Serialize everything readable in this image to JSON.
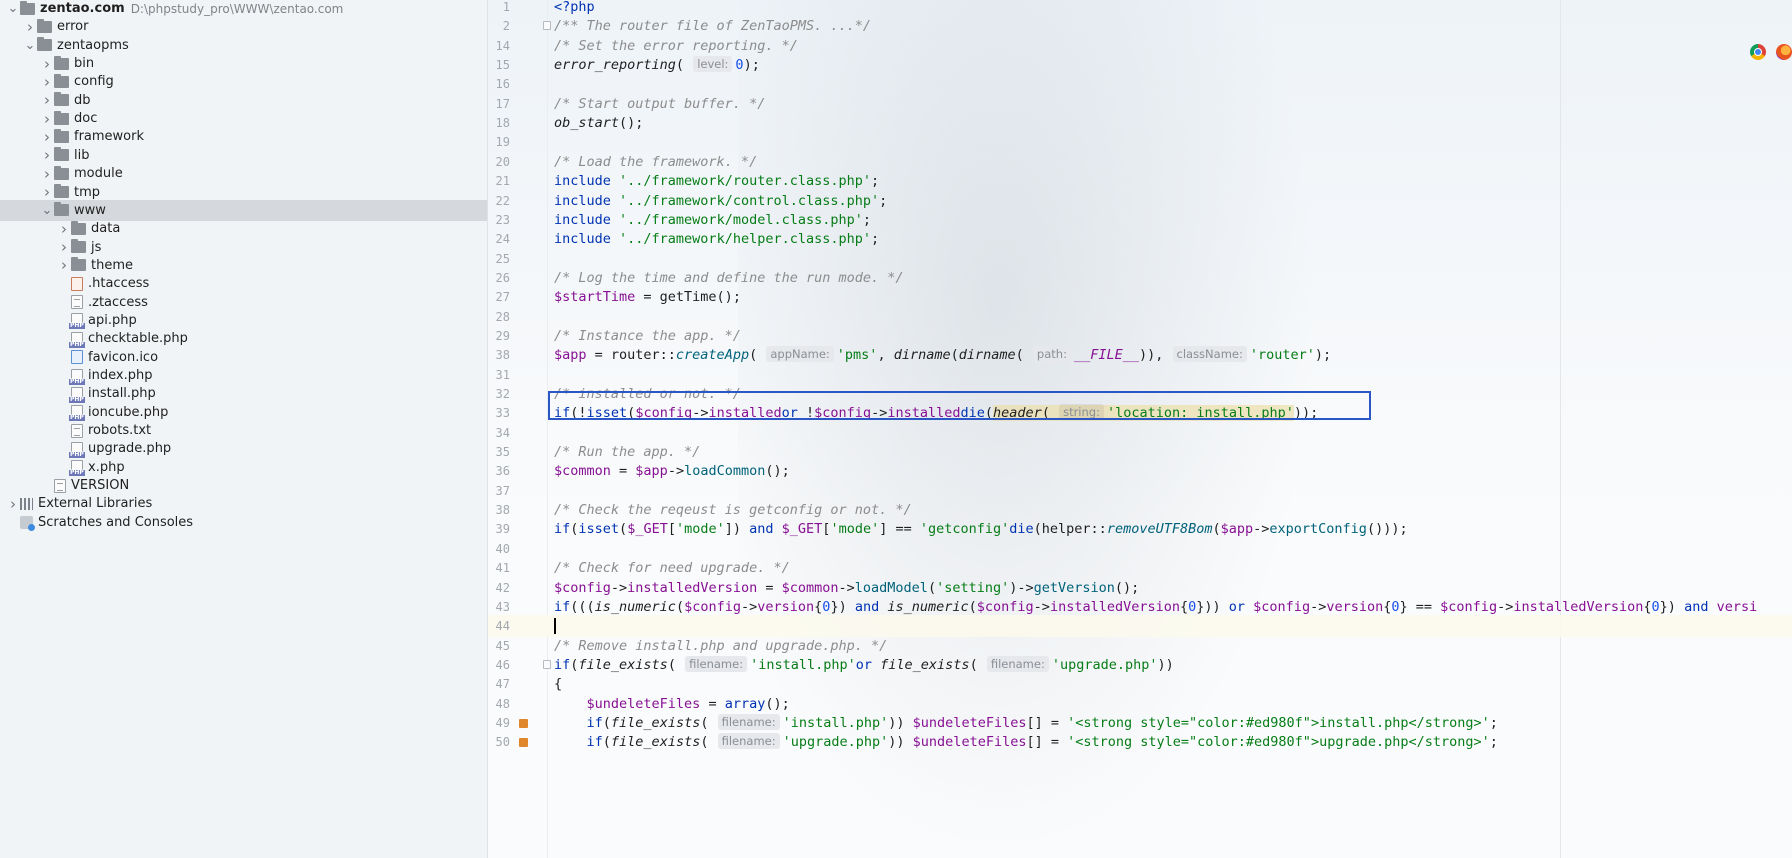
{
  "project_tree": {
    "rows": [
      {
        "depth": 0,
        "type": "folder",
        "expanded": true,
        "label": "zentao.com",
        "path": "D:\\phpstudy_pro\\WWW\\zentao.com",
        "bold": true
      },
      {
        "depth": 1,
        "type": "folder",
        "expanded": false,
        "label": "error"
      },
      {
        "depth": 1,
        "type": "folder",
        "expanded": true,
        "label": "zentaopms"
      },
      {
        "depth": 2,
        "type": "folder",
        "expanded": false,
        "label": "bin"
      },
      {
        "depth": 2,
        "type": "folder",
        "expanded": false,
        "label": "config"
      },
      {
        "depth": 2,
        "type": "folder",
        "expanded": false,
        "label": "db"
      },
      {
        "depth": 2,
        "type": "folder",
        "expanded": false,
        "label": "doc"
      },
      {
        "depth": 2,
        "type": "folder",
        "expanded": false,
        "label": "framework"
      },
      {
        "depth": 2,
        "type": "folder",
        "expanded": false,
        "label": "lib"
      },
      {
        "depth": 2,
        "type": "folder",
        "expanded": false,
        "label": "module"
      },
      {
        "depth": 2,
        "type": "folder",
        "expanded": false,
        "label": "tmp"
      },
      {
        "depth": 2,
        "type": "folder",
        "expanded": true,
        "label": "www",
        "selected": true
      },
      {
        "depth": 3,
        "type": "folder",
        "expanded": false,
        "label": "data"
      },
      {
        "depth": 3,
        "type": "folder",
        "expanded": false,
        "label": "js"
      },
      {
        "depth": 3,
        "type": "folder",
        "expanded": false,
        "label": "theme"
      },
      {
        "depth": 3,
        "type": "file",
        "icon": "htaccess",
        "label": ".htaccess"
      },
      {
        "depth": 3,
        "type": "file",
        "icon": "plain",
        "label": ".ztaccess"
      },
      {
        "depth": 3,
        "type": "file",
        "icon": "php",
        "label": "api.php"
      },
      {
        "depth": 3,
        "type": "file",
        "icon": "php",
        "label": "checktable.php"
      },
      {
        "depth": 3,
        "type": "file",
        "icon": "img",
        "label": "favicon.ico"
      },
      {
        "depth": 3,
        "type": "file",
        "icon": "php",
        "label": "index.php"
      },
      {
        "depth": 3,
        "type": "file",
        "icon": "php",
        "label": "install.php"
      },
      {
        "depth": 3,
        "type": "file",
        "icon": "php",
        "label": "ioncube.php"
      },
      {
        "depth": 3,
        "type": "file",
        "icon": "txt",
        "label": "robots.txt"
      },
      {
        "depth": 3,
        "type": "file",
        "icon": "php",
        "label": "upgrade.php"
      },
      {
        "depth": 3,
        "type": "file",
        "icon": "php",
        "label": "x.php"
      },
      {
        "depth": 2,
        "type": "file",
        "icon": "plain",
        "label": "VERSION"
      },
      {
        "depth": 0,
        "type": "library",
        "expanded": false,
        "label": "External Libraries"
      },
      {
        "depth": 0,
        "type": "scratch",
        "label": "Scratches and Consoles"
      }
    ]
  },
  "editor": {
    "selected_line": "38",
    "current_line": "44",
    "lines": [
      {
        "n": "1",
        "parts": [
          [
            "k",
            "<?php"
          ]
        ]
      },
      {
        "n": "2",
        "fold": true,
        "parts": [
          [
            "c",
            "/** The router file of ZenTaoPMS. ...*/"
          ]
        ]
      },
      {
        "n": "14",
        "parts": [
          [
            "c",
            "/* Set the error reporting. */"
          ]
        ]
      },
      {
        "n": "15",
        "parts": [
          [
            "fb",
            "error_reporting"
          ],
          [
            "",
            "( "
          ],
          [
            "hint",
            "level:"
          ],
          [
            "n",
            "0"
          ],
          [
            "",
            ");"
          ]
        ]
      },
      {
        "n": "16",
        "parts": []
      },
      {
        "n": "17",
        "parts": [
          [
            "c",
            "/* Start output buffer. */"
          ]
        ]
      },
      {
        "n": "18",
        "parts": [
          [
            "fb",
            "ob_start"
          ],
          [
            "",
            "();"
          ]
        ]
      },
      {
        "n": "19",
        "parts": []
      },
      {
        "n": "20",
        "parts": [
          [
            "c",
            "/* Load the framework. */"
          ]
        ]
      },
      {
        "n": "21",
        "parts": [
          [
            "k",
            "include "
          ],
          [
            "s",
            "'../framework/router.class.php'"
          ],
          [
            "",
            ";"
          ]
        ]
      },
      {
        "n": "22",
        "parts": [
          [
            "k",
            "include "
          ],
          [
            "s",
            "'../framework/control.class.php'"
          ],
          [
            "",
            ";"
          ]
        ]
      },
      {
        "n": "23",
        "parts": [
          [
            "k",
            "include "
          ],
          [
            "s",
            "'../framework/model.class.php'"
          ],
          [
            "",
            ";"
          ]
        ]
      },
      {
        "n": "24",
        "parts": [
          [
            "k",
            "include "
          ],
          [
            "s",
            "'../framework/helper.class.php'"
          ],
          [
            "",
            ";"
          ]
        ]
      },
      {
        "n": "25",
        "parts": []
      },
      {
        "n": "26",
        "parts": [
          [
            "c",
            "/* Log the time and define the run mode. */"
          ]
        ]
      },
      {
        "n": "27",
        "parts": [
          [
            "v",
            "$startTime"
          ],
          [
            "",
            " = getTime();"
          ]
        ]
      },
      {
        "n": "28",
        "parts": []
      },
      {
        "n": "29",
        "parts": [
          [
            "c",
            "/* Instance the app. */"
          ]
        ]
      },
      {
        "n": "38",
        "parts": [
          [
            "v",
            "$app"
          ],
          [
            "",
            " = router::"
          ],
          [
            "fi",
            "createApp"
          ],
          [
            "",
            "( "
          ],
          [
            "hint",
            "appName:"
          ],
          [
            "s",
            "'pms'"
          ],
          [
            "",
            ", "
          ],
          [
            "fb",
            "dirname"
          ],
          [
            "",
            "("
          ],
          [
            "fb",
            "dirname"
          ],
          [
            "",
            "( "
          ],
          [
            "hint",
            "path:"
          ],
          [
            "cst",
            "__FILE__"
          ],
          [
            "",
            ")), "
          ],
          [
            "hint",
            "className:"
          ],
          [
            "s",
            "'router'"
          ],
          [
            "",
            ");"
          ]
        ]
      },
      {
        "n": "31",
        "parts": []
      },
      {
        "n": "32",
        "parts": [
          [
            "c",
            "/* installed or not. */"
          ]
        ]
      },
      {
        "n": "33",
        "parts": [
          [
            "k",
            "if"
          ],
          [
            "",
            "(!"
          ],
          [
            "k",
            "isset"
          ],
          [
            "",
            "("
          ],
          [
            "v",
            "$config"
          ],
          [
            "",
            "->"
          ],
          [
            "m",
            "installed"
          ],
          [
            ") "
          ],
          [
            "k",
            "or "
          ],
          [
            "",
            "!"
          ],
          [
            "v",
            "$config"
          ],
          [
            "",
            "->"
          ],
          [
            "m",
            "installed"
          ],
          [
            ") "
          ],
          [
            "k",
            "die"
          ],
          [
            "",
            "("
          ],
          [
            "hlstart",
            ""
          ],
          [
            "fb",
            "header"
          ],
          [
            "",
            "( "
          ],
          [
            "hint",
            "string:"
          ],
          [
            "s",
            "'location: install.php'"
          ],
          [
            "hlend",
            ""
          ],
          [
            "",
            "));"
          ]
        ]
      },
      {
        "n": "34",
        "parts": []
      },
      {
        "n": "35",
        "parts": [
          [
            "c",
            "/* Run the app. */"
          ]
        ]
      },
      {
        "n": "36",
        "parts": [
          [
            "v",
            "$common"
          ],
          [
            "",
            " = "
          ],
          [
            "v",
            "$app"
          ],
          [
            "",
            "->"
          ],
          [
            "f",
            "loadCommon"
          ],
          [
            "",
            "();"
          ]
        ]
      },
      {
        "n": "37",
        "parts": []
      },
      {
        "n": "38b",
        "label": "38",
        "parts": [
          [
            "c",
            "/* Check the reqeust is getconfig or not. */"
          ]
        ]
      },
      {
        "n": "39",
        "parts": [
          [
            "k",
            "if"
          ],
          [
            "",
            "("
          ],
          [
            "k",
            "isset"
          ],
          [
            "",
            "("
          ],
          [
            "v",
            "$_GET"
          ],
          [
            "",
            "["
          ],
          [
            "s",
            "'mode'"
          ],
          [
            "",
            "]) "
          ],
          [
            "k",
            "and "
          ],
          [
            "v",
            "$_GET"
          ],
          [
            "",
            "["
          ],
          [
            "s",
            "'mode'"
          ],
          [
            "",
            "] == "
          ],
          [
            "s",
            "'getconfig'"
          ],
          [
            ") "
          ],
          [
            "k",
            "die"
          ],
          [
            "",
            "(helper::"
          ],
          [
            "fi",
            "removeUTF8Bom"
          ],
          [
            "",
            "("
          ],
          [
            "v",
            "$app"
          ],
          [
            "",
            "->"
          ],
          [
            "f",
            "exportConfig"
          ],
          [
            "",
            "()));"
          ]
        ]
      },
      {
        "n": "40",
        "parts": []
      },
      {
        "n": "41",
        "parts": [
          [
            "c",
            "/* Check for need upgrade. */"
          ]
        ]
      },
      {
        "n": "42",
        "parts": [
          [
            "v",
            "$config"
          ],
          [
            "",
            "->"
          ],
          [
            "m",
            "installedVersion"
          ],
          [
            "",
            " = "
          ],
          [
            "v",
            "$common"
          ],
          [
            "",
            "->"
          ],
          [
            "f",
            "loadModel"
          ],
          [
            "",
            "("
          ],
          [
            "s",
            "'setting'"
          ],
          [
            "",
            ")->"
          ],
          [
            "f",
            "getVersion"
          ],
          [
            "",
            "();"
          ]
        ]
      },
      {
        "n": "43",
        "parts": [
          [
            "k",
            "if"
          ],
          [
            "",
            "((("
          ],
          [
            "fb",
            "is_numeric"
          ],
          [
            "",
            "("
          ],
          [
            "v",
            "$config"
          ],
          [
            "",
            "->"
          ],
          [
            "m",
            "version"
          ],
          [
            "",
            "{"
          ],
          [
            "n",
            "0"
          ],
          [
            "",
            "}) "
          ],
          [
            "k",
            "and "
          ],
          [
            "fb",
            "is_numeric"
          ],
          [
            "",
            "("
          ],
          [
            "v",
            "$config"
          ],
          [
            "",
            "->"
          ],
          [
            "m",
            "installedVersion"
          ],
          [
            "",
            "{"
          ],
          [
            "n",
            "0"
          ],
          [
            "",
            "})) "
          ],
          [
            "k",
            "or "
          ],
          [
            "v",
            "$config"
          ],
          [
            "",
            "->"
          ],
          [
            "m",
            "version"
          ],
          [
            "",
            "{"
          ],
          [
            "n",
            "0"
          ],
          [
            "",
            "} == "
          ],
          [
            "v",
            "$config"
          ],
          [
            "",
            "->"
          ],
          [
            "m",
            "installedVersion"
          ],
          [
            "",
            "{"
          ],
          [
            "n",
            "0"
          ],
          [
            "",
            "}) "
          ],
          [
            "k",
            "and "
          ],
          [
            "m",
            "versi"
          ]
        ]
      },
      {
        "n": "44",
        "parts": []
      },
      {
        "n": "45",
        "parts": [
          [
            "c",
            "/* Remove install.php and upgrade.php. */"
          ]
        ]
      },
      {
        "n": "46",
        "fold": true,
        "parts": [
          [
            "k",
            "if"
          ],
          [
            "",
            "("
          ],
          [
            "fb",
            "file_exists"
          ],
          [
            "",
            "( "
          ],
          [
            "hint",
            "filename:"
          ],
          [
            "s",
            "'install.php'"
          ],
          [
            ") "
          ],
          [
            "k",
            "or "
          ],
          [
            "fb",
            "file_exists"
          ],
          [
            "",
            "( "
          ],
          [
            "hint",
            "filename:"
          ],
          [
            "s",
            "'upgrade.php'"
          ],
          [
            "",
            "))"
          ]
        ]
      },
      {
        "n": "47",
        "parts": [
          [
            "",
            "{"
          ]
        ]
      },
      {
        "n": "48",
        "parts": [
          [
            "",
            "    "
          ],
          [
            "v",
            "$undeleteFiles"
          ],
          [
            "",
            " = "
          ],
          [
            "k",
            "array"
          ],
          [
            "",
            "();"
          ]
        ]
      },
      {
        "n": "49",
        "bp": true,
        "parts": [
          [
            "",
            "    "
          ],
          [
            "k",
            "if"
          ],
          [
            "",
            "("
          ],
          [
            "fb",
            "file_exists"
          ],
          [
            "",
            "( "
          ],
          [
            "hint",
            "filename:"
          ],
          [
            "s",
            "'install.php'"
          ],
          [
            "",
            ")) "
          ],
          [
            "v",
            "$undeleteFiles"
          ],
          [
            "",
            "[] = "
          ],
          [
            "s",
            "'<strong style=\"color:#ed980f\">install.php</strong>'"
          ],
          [
            "",
            ";"
          ]
        ]
      },
      {
        "n": "50",
        "bp": true,
        "parts": [
          [
            "",
            "    "
          ],
          [
            "k",
            "if"
          ],
          [
            "",
            "("
          ],
          [
            "fb",
            "file_exists"
          ],
          [
            "",
            "( "
          ],
          [
            "hint",
            "filename:"
          ],
          [
            "s",
            "'upgrade.php'"
          ],
          [
            "",
            ")) "
          ],
          [
            "v",
            "$undeleteFiles"
          ],
          [
            "",
            "[] = "
          ],
          [
            "s",
            "'<strong style=\"color:#ed980f\">upgrade.php</strong>'"
          ],
          [
            "",
            ";"
          ]
        ]
      }
    ]
  },
  "browser_icons": [
    "chrome-icon",
    "firefox-icon"
  ]
}
